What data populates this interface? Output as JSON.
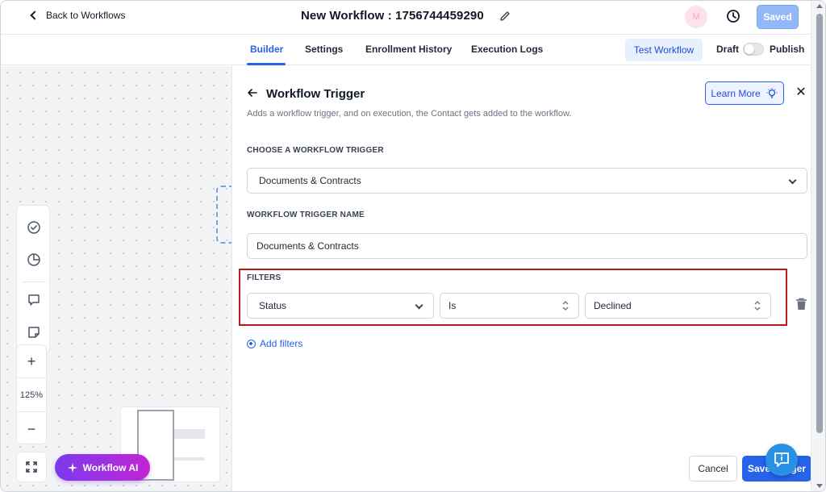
{
  "header": {
    "back_label": "Back to Workflows",
    "title": "New Workflow : 1756744459290",
    "avatar_initials": "M",
    "saved_label": "Saved"
  },
  "tabs": [
    {
      "label": "Builder",
      "active": true
    },
    {
      "label": "Settings",
      "active": false
    },
    {
      "label": "Enrollment History",
      "active": false
    },
    {
      "label": "Execution Logs",
      "active": false
    }
  ],
  "toolbar": {
    "test_workflow_label": "Test Workflow",
    "draft_label": "Draft",
    "publish_label": "Publish",
    "publish_enabled": false
  },
  "canvas": {
    "zoom_level": "125%",
    "zoom_in_label": "+",
    "zoom_out_label": "−",
    "ai_button_label": "Workflow AI",
    "tools": [
      "check-circle-icon",
      "pie-chart-icon",
      "comment-icon",
      "sticky-note-icon"
    ]
  },
  "panel": {
    "title": "Workflow Trigger",
    "description": "Adds a workflow trigger, and on execution, the Contact gets added to the workflow.",
    "learn_more_label": "Learn More",
    "choose_trigger_label": "CHOOSE A WORKFLOW TRIGGER",
    "trigger_value": "Documents & Contracts",
    "trigger_name_label": "WORKFLOW TRIGGER NAME",
    "trigger_name_value": "Documents & Contracts",
    "filters_label": "FILTERS",
    "filters": [
      {
        "field": "Status",
        "operator": "Is",
        "value": "Declined"
      }
    ],
    "add_filters_label": "Add filters",
    "cancel_label": "Cancel",
    "save_trigger_label": "Save Trigger"
  },
  "colors": {
    "accent": "#2563eb",
    "highlight_border": "#b91c1c",
    "ai_gradient_start": "#7c3aed",
    "ai_gradient_end": "#c026d3"
  }
}
